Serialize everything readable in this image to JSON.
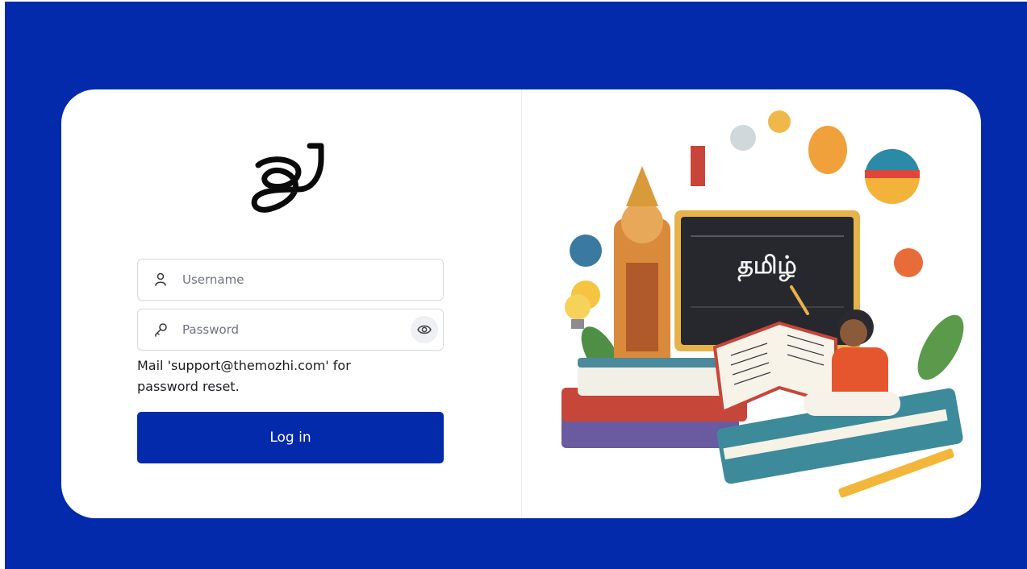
{
  "brand": {
    "logo_name": "mozhi-logo",
    "colors": {
      "primary": "#022aab",
      "card": "#ffffff"
    }
  },
  "login_form": {
    "username": {
      "placeholder": "Username",
      "value": "",
      "icon": "user-icon"
    },
    "password": {
      "placeholder": "Password",
      "value": "",
      "icon": "key-icon",
      "toggle_icon": "eye-icon"
    },
    "reset_note": "Mail 'support@themozhi.com' for password reset.",
    "submit_label": "Log in"
  },
  "illustration": {
    "chalkboard_text": "தமிழ்"
  }
}
